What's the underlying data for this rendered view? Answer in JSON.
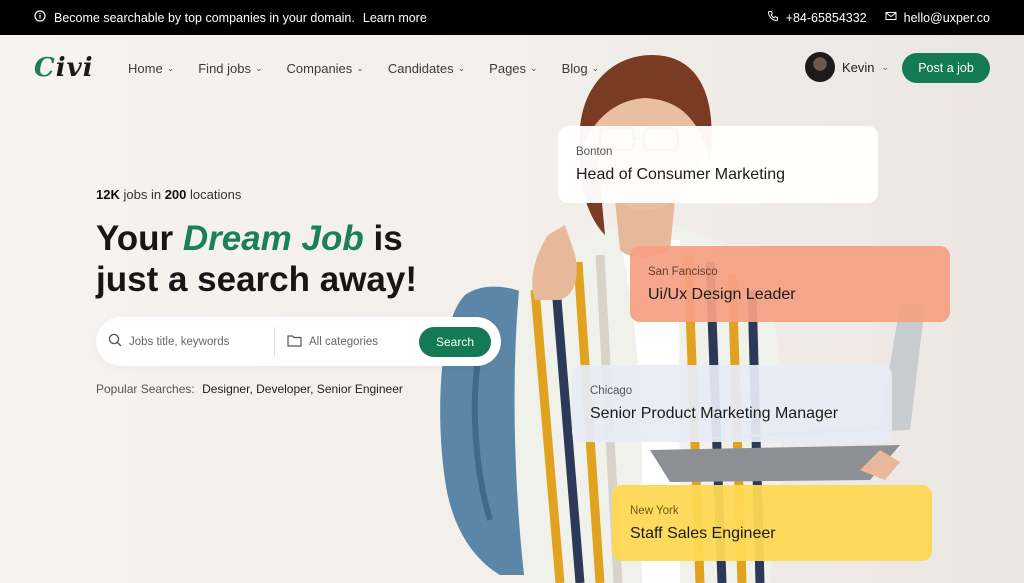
{
  "topbar": {
    "announcement": "Become searchable by top companies in your domain.",
    "learn_more": "Learn more",
    "phone": "+84-65854332",
    "email": "hello@uxper.co"
  },
  "header": {
    "logo_c": "C",
    "logo_rest": "ivi",
    "nav": [
      {
        "label": "Home"
      },
      {
        "label": "Find jobs"
      },
      {
        "label": "Companies"
      },
      {
        "label": "Candidates"
      },
      {
        "label": "Pages"
      },
      {
        "label": "Blog"
      }
    ],
    "user_name": "Kevin",
    "post_job": "Post a job"
  },
  "hero": {
    "jobs_count": "12K",
    "jobs_in": "jobs in",
    "locations_count": "200",
    "locations_label": "locations",
    "headline_pre": "Your ",
    "headline_accent": "Dream Job",
    "headline_post": " is just a search away!",
    "search": {
      "keyword_placeholder": "Jobs title, keywords",
      "category_placeholder": "All categories",
      "button": "Search"
    },
    "popular_label": "Popular Searches:",
    "popular_terms": "Designer, Developer, Senior Engineer"
  },
  "job_cards": [
    {
      "location": "Bonton",
      "title": "Head of Consumer Marketing"
    },
    {
      "location": "San Fancisco",
      "title": "Ui/Ux Design Leader"
    },
    {
      "location": "Chicago",
      "title": "Senior Product Marketing Manager"
    },
    {
      "location": "New York",
      "title": "Staff Sales Engineer"
    }
  ],
  "colors": {
    "brand": "#137a55",
    "card_peach": "#f5a082",
    "card_blue": "#e6ecf5",
    "card_yellow": "#fdd854"
  }
}
